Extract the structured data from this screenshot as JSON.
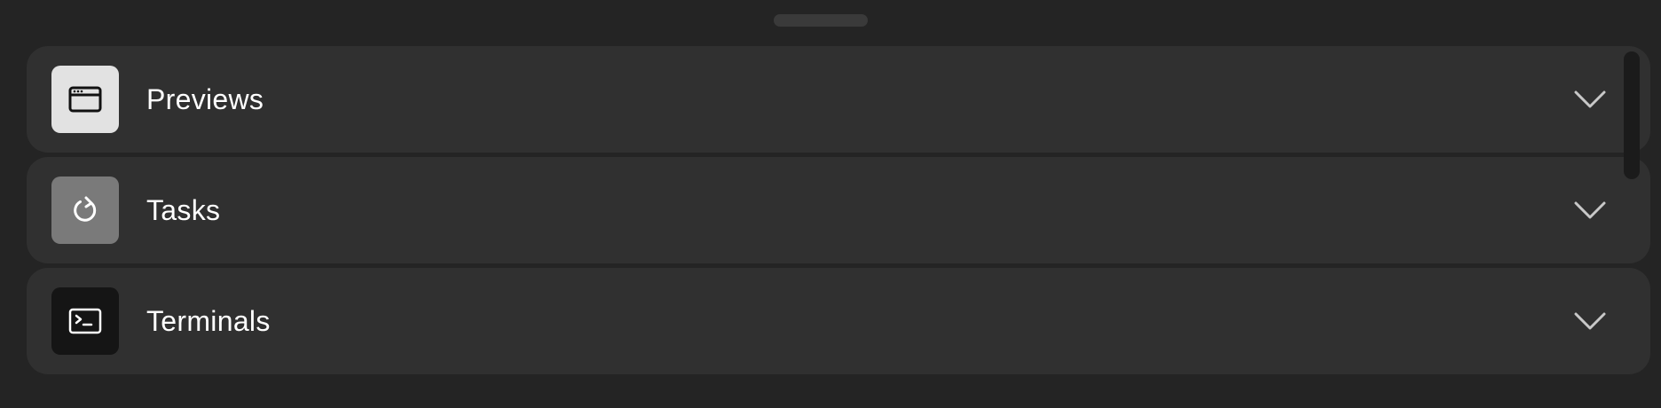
{
  "sheet": {
    "sections": [
      {
        "label": "Previews",
        "icon": "browser-window-icon",
        "icon_bg": "#e2e2e2",
        "expanded": false
      },
      {
        "label": "Tasks",
        "icon": "refresh-icon",
        "icon_bg": "#7a7a7a",
        "expanded": false
      },
      {
        "label": "Terminals",
        "icon": "terminal-icon",
        "icon_bg": "#151515",
        "expanded": false
      }
    ]
  },
  "colors": {
    "background": "#242424",
    "card": "#303030",
    "text": "#ffffff",
    "chevron": "#c8c8c8"
  }
}
